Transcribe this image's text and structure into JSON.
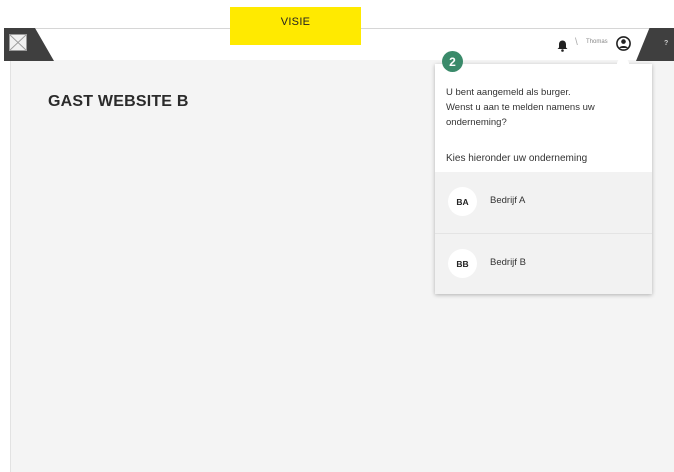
{
  "banner": {
    "label": "VISIE"
  },
  "header": {
    "logo_icon": "image-placeholder-icon",
    "notification_icon": "bell-icon",
    "separator": "\\",
    "username": "Thomas",
    "user_icon": "user-circle-icon",
    "help_label": "?"
  },
  "page": {
    "title": "GAST WEBSITE B"
  },
  "popup": {
    "step": "2",
    "line1": "U bent aangemeld als burger.",
    "line2": "Wenst u aan te melden namens uw",
    "line3": "onderneming?",
    "choose_label": "Kies hieronder uw onderneming",
    "companies": [
      {
        "initials": "BA",
        "name": "Bedrijf A"
      },
      {
        "initials": "BB",
        "name": "Bedrijf B"
      }
    ]
  },
  "colors": {
    "banner": "#ffea00",
    "header_dark": "#3f3f3f",
    "content_bg": "#f4f4f4",
    "step_badge": "#3a8a6a"
  }
}
